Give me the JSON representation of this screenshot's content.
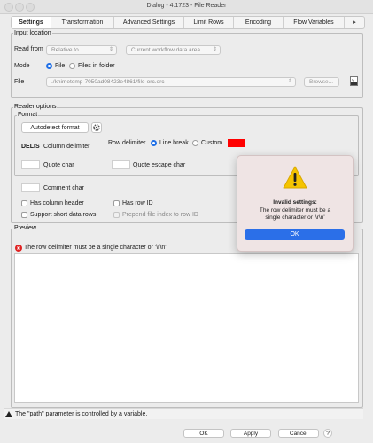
{
  "window": {
    "title": "Dialog - 4:1723 - File Reader"
  },
  "tabs": [
    "Settings",
    "Transformation",
    "Advanced Settings",
    "Limit Rows",
    "Encoding",
    "Flow Variables"
  ],
  "tabs_more": "▸",
  "input_location": {
    "group_label": "Input location",
    "read_from_label": "Read from",
    "read_from_value": "Relative to",
    "relative_value": "Current workflow data area",
    "mode_label": "Mode",
    "mode_file": "File",
    "mode_folder": "Files in folder",
    "file_label": "File",
    "file_value": "./knimetemp-7050ad08423e4861/file-orc.orc",
    "browse_label": "Browse..."
  },
  "reader_options": {
    "group_label": "Reader options",
    "format_label": "Format",
    "autodetect_label": "Autodetect format",
    "column_delim_value": "DELIS",
    "column_delim_label": "Column delimiter",
    "row_delim_label": "Row delimiter",
    "line_break_label": "Line break",
    "custom_label": "Custom",
    "quote_char_label": "Quote char",
    "quote_escape_label": "Quote escape char",
    "comment_char_label": "Comment char",
    "has_column_header": "Has column header",
    "has_row_id": "Has row ID",
    "short_data_rows": "Support short data rows",
    "prepend_index": "Prepend file index to row ID"
  },
  "preview": {
    "group_label": "Preview",
    "error_text": "The row delimiter must be a single character or '\\r\\n'"
  },
  "status": {
    "text": "The \"path\" parameter is controlled by a variable."
  },
  "footer": {
    "ok": "OK",
    "apply": "Apply",
    "cancel": "Cancel",
    "help": "?"
  },
  "alert": {
    "title": "Invalid settings:",
    "line2": "The row delimiter must be a",
    "line3": "single character or '\\r\\n'",
    "ok": "OK"
  },
  "colors": {
    "accent": "#2b6fe8",
    "error": "#e02020",
    "custom_swatch": "#ff0000"
  },
  "icons": {
    "gear": "gear-icon",
    "warning": "warning-icon",
    "error": "error-icon",
    "variable": "flow-variable-icon"
  }
}
